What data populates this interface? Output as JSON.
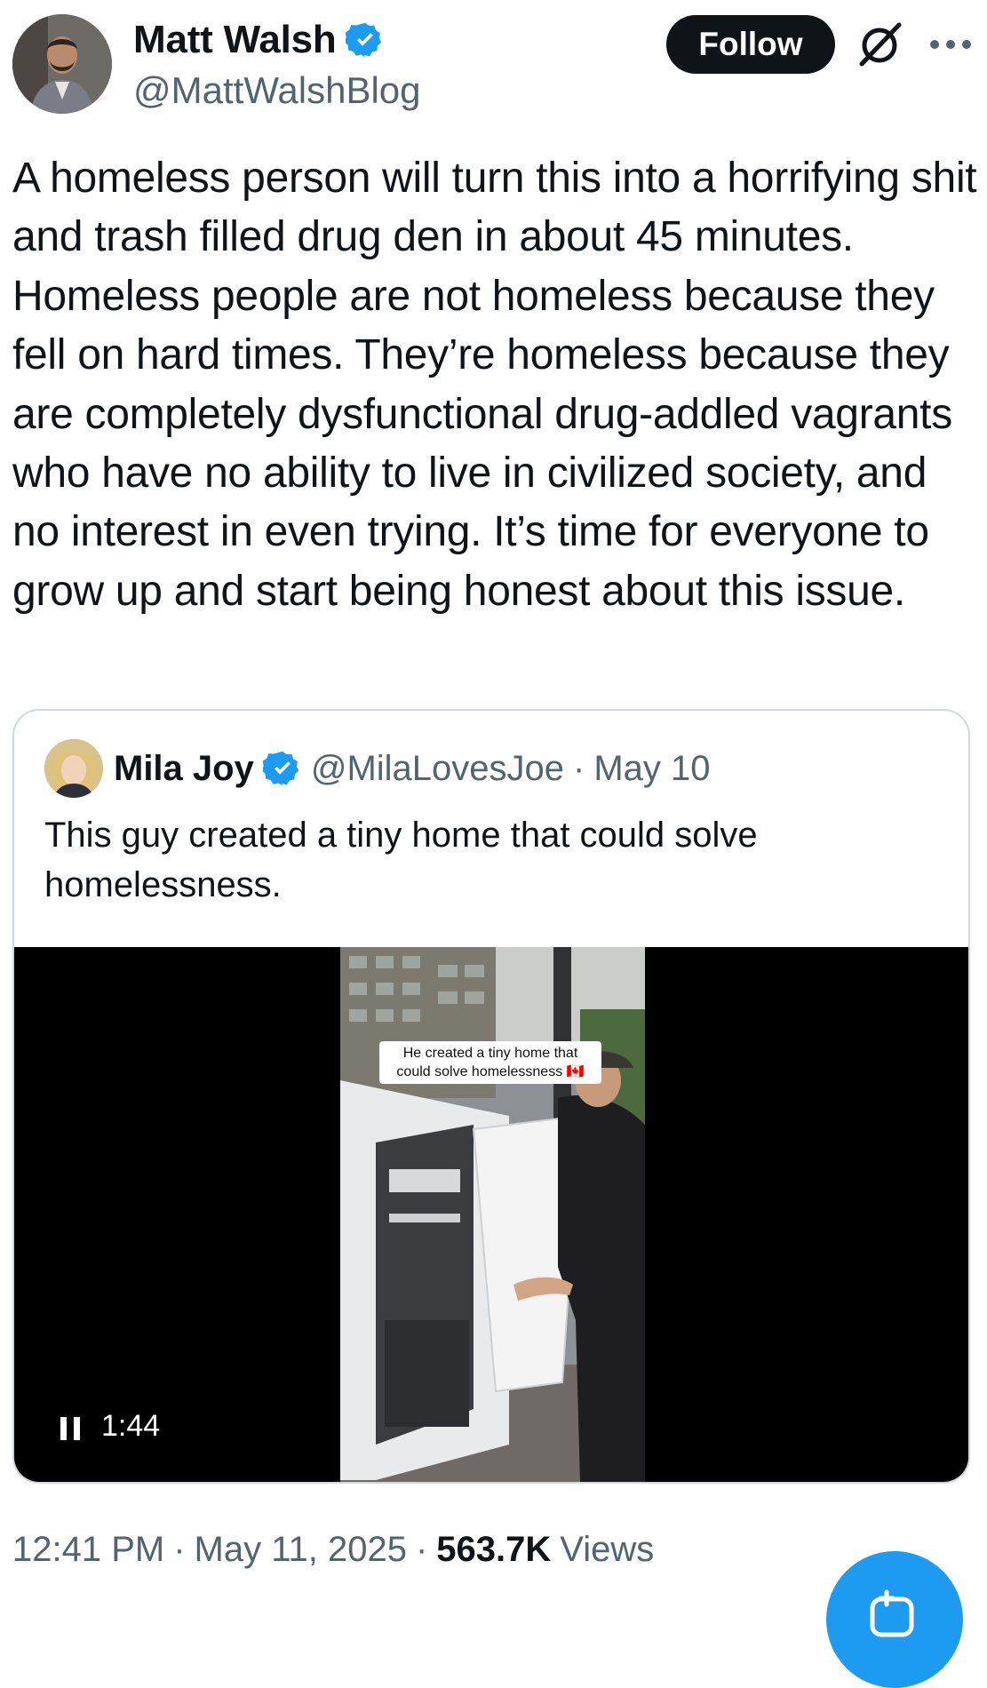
{
  "author": {
    "display_name": "Matt Walsh",
    "handle": "@MattWalshBlog",
    "avatar_icon": "profile-photo",
    "verified_icon": "verified-badge-icon"
  },
  "header": {
    "follow_label": "Follow",
    "grok_icon": "grok-icon",
    "more_icon": "more-options-icon"
  },
  "tweet": {
    "text": "A homeless person will turn this into a horrifying shit and trash filled drug den in about 45 minutes. Homeless people are not homeless because they fell on hard times. They’re homeless because they are completely dysfunctional drug-addled vagrants who have no ability to live in civilized society, and no interest in even trying. It’s time for everyone to grow up and start being honest about this issue."
  },
  "quote": {
    "display_name": "Mila Joy",
    "handle": "@MilaLovesJoe",
    "separator": "·",
    "date": "May 10",
    "text": "This guy created a tiny home that could solve homelessness.",
    "video": {
      "caption": "He created a tiny home that could solve homelessness 🇨🇦",
      "duration": "1:44",
      "control_icon": "pause-icon"
    }
  },
  "footer": {
    "time": "12:41 PM",
    "sep1": "·",
    "date": "May 11, 2025",
    "sep2": "·",
    "views_count": "563.7K",
    "views_label": "Views"
  },
  "fab": {
    "icon": "compose-icon"
  },
  "colors": {
    "accent": "#1d9bf0",
    "text": "#0f1419",
    "secondary": "#536471",
    "border": "#cfd9de"
  }
}
